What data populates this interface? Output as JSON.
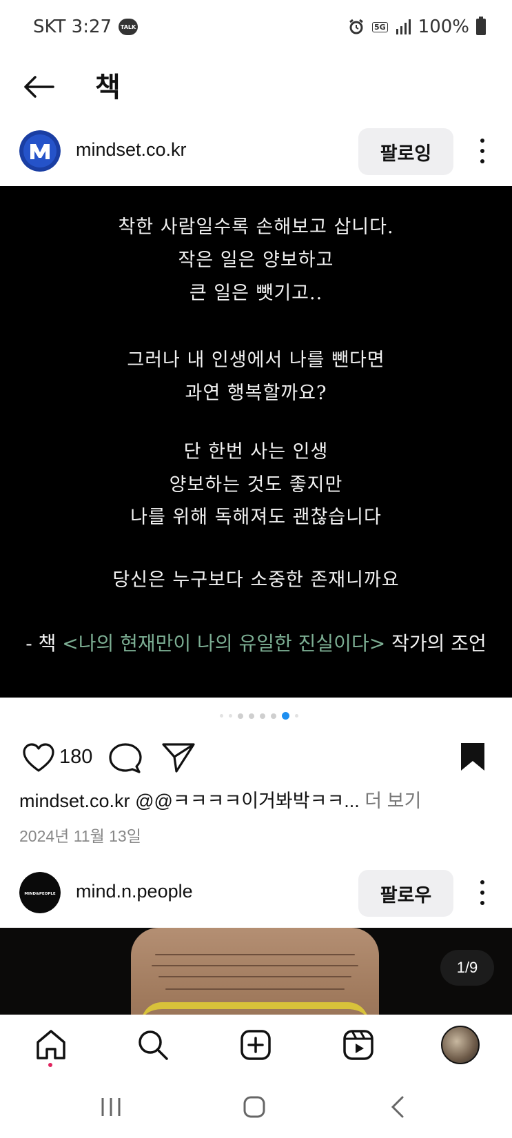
{
  "status_bar": {
    "carrier_time": "SKT 3:27",
    "talk_badge": "TALK",
    "network": "5G",
    "battery": "100%"
  },
  "header": {
    "title": "책"
  },
  "post1": {
    "username": "mindset.co.kr",
    "follow_label": "팔로잉",
    "quote_lines": [
      "착한 사람일수록 손해보고 삽니다.",
      "작은 일은 양보하고",
      "큰 일은 뺏기고..",
      "",
      "그러나 내 인생에서 나를 뺀다면",
      "과연 행복할까요?",
      "",
      "단 한번 사는 인생",
      "양보하는 것도 좋지만",
      "나를 위해 독해져도 괜찮습니다",
      "",
      "당신은 누구보다 소중한 존재니까요"
    ],
    "attribution_prefix": "- 책 ",
    "attribution_book": "<나의 현재만이 나의 유일한 진실이다>",
    "attribution_suffix": " 작가의 조언",
    "carousel_total": 7,
    "carousel_active": 6,
    "like_count": "180",
    "caption_user": "mindset.co.kr",
    "caption_text": " @@ㅋㅋㅋㅋ이거봐박ㅋㅋ...",
    "caption_more": " 더 보기",
    "date": "2024년 11월 13일"
  },
  "post2": {
    "username": "mind.n.people",
    "avatar_text": "MIND&PEOPLE",
    "follow_label": "팔로우",
    "page_indicator": "1/9"
  },
  "icons": {
    "back": "arrow-left-icon",
    "like": "heart-icon",
    "comment": "speech-bubble-icon",
    "share": "paper-plane-icon",
    "save": "bookmark-icon",
    "home": "home-icon",
    "search": "search-icon",
    "create": "plus-square-icon",
    "reels": "reels-icon"
  },
  "colors": {
    "accent_blue": "#1e8ff0",
    "book_title_green": "#7cae93",
    "follow_button_bg": "#efeff1",
    "notification_dot": "#e0245e"
  }
}
